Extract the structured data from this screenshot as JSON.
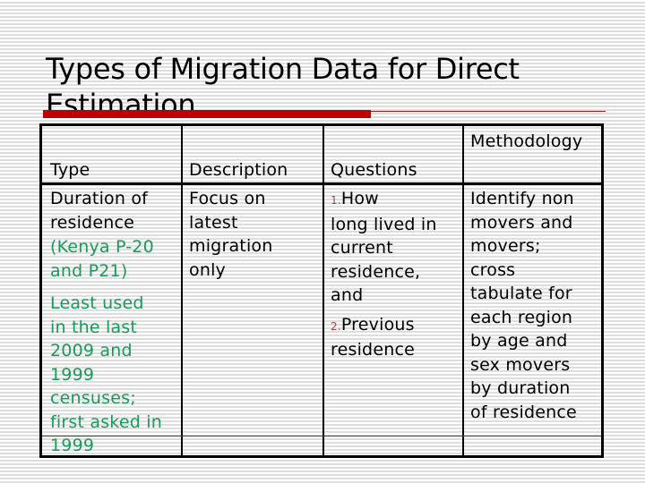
{
  "slide": {
    "title": "Types of Migration Data for Direct Estimation",
    "accent_color": "#c00000"
  },
  "table": {
    "headers": {
      "type": "Type",
      "description": "Description",
      "questions": "Questions",
      "methodology": "Methodology"
    },
    "rows": [
      {
        "type": {
          "main_line1": "Duration of",
          "main_line2": "residence",
          "note_lines": [
            "(Kenya P-20",
            "and P21)",
            "Least used",
            "in the last",
            "2009 and",
            "1999",
            "censuses;",
            "first asked in",
            "1999"
          ]
        },
        "description_lines": [
          "Focus on",
          "latest",
          "migration",
          "only"
        ],
        "questions": [
          {
            "number": "1.",
            "lines": [
              "How",
              "long lived in",
              "current",
              "residence,",
              "and"
            ]
          },
          {
            "number": "2.",
            "lines": [
              "Previous",
              "residence"
            ]
          }
        ],
        "methodology_lines": [
          "Identify non",
          "movers and",
          "movers;",
          "cross",
          "tabulate for",
          "each region",
          "by age and",
          "sex movers",
          "by duration",
          "of residence"
        ]
      }
    ]
  },
  "colors": {
    "note_text": "#1a9a5a",
    "list_number": "#b04040"
  }
}
